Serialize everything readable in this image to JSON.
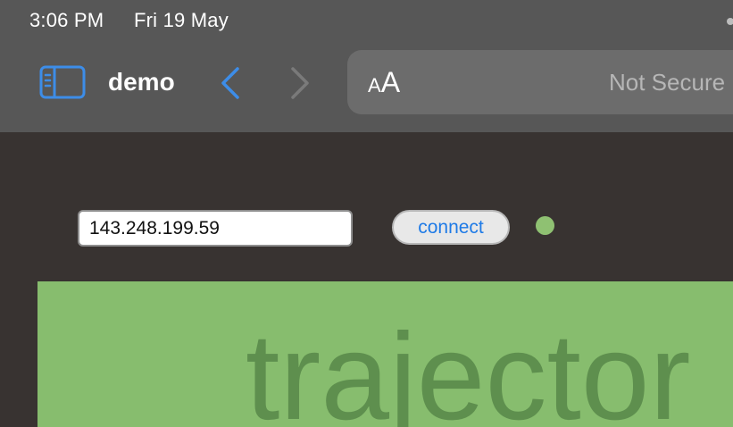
{
  "status_bar": {
    "time": "3:06 PM",
    "date": "Fri 19 May"
  },
  "toolbar": {
    "tab_title": "demo",
    "text_size_label_small": "A",
    "text_size_label_large": "A",
    "security_label": "Not Secure",
    "icons": {
      "sidebar": "sidebar-icon",
      "back": "chevron-left-icon",
      "forward": "chevron-right-icon"
    }
  },
  "page": {
    "ip_input": {
      "value": "143.248.199.59"
    },
    "connect_label": "connect",
    "status_color": "#8fc172",
    "panel": {
      "heading": "trajector",
      "background": "#87bd6e"
    }
  },
  "colors": {
    "chrome": "#575757",
    "content_background": "#383331",
    "accent": "#1e7ae6"
  }
}
